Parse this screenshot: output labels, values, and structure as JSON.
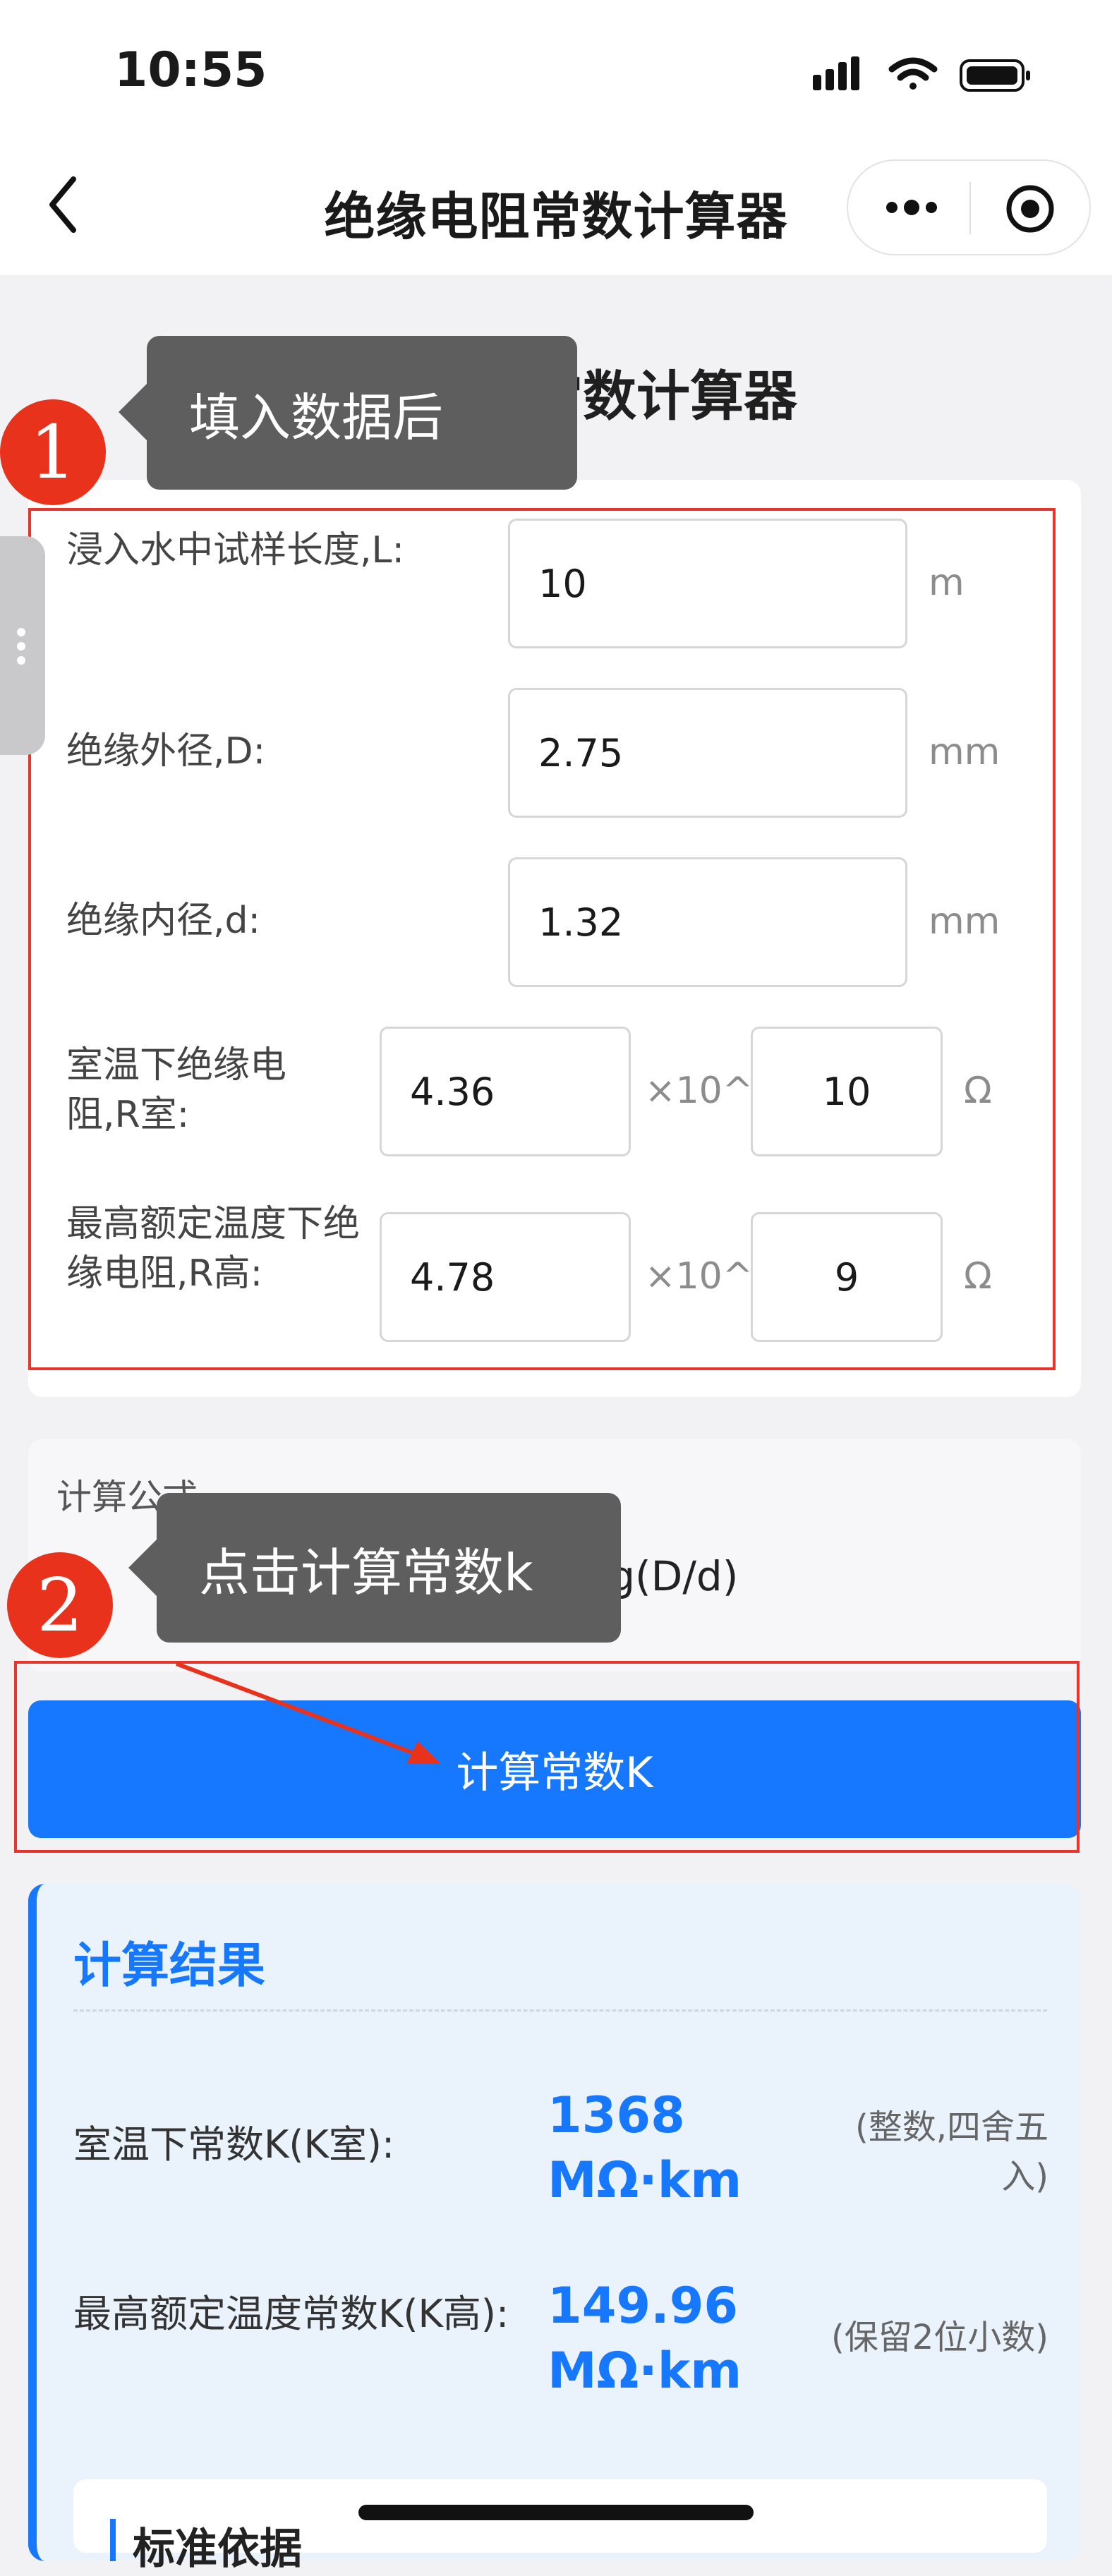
{
  "status_bar": {
    "time": "10:55"
  },
  "nav": {
    "title": "绝缘电阻常数计算器"
  },
  "page": {
    "heading": "绝缘电阻常数计算器"
  },
  "annotations": {
    "step1_badge": "1",
    "step1_tip": "填入数据后",
    "step2_badge": "2",
    "step2_tip": "点击计算常数k"
  },
  "form": {
    "length_label": "浸入水中试样长度,L:",
    "length_value": "10",
    "length_unit": "m",
    "outer_label": "绝缘外径,D:",
    "outer_value": "2.75",
    "outer_unit": "mm",
    "inner_label": "绝缘内径,d:",
    "inner_value": "1.32",
    "inner_unit": "mm",
    "rroom_label": "室温下绝缘电阻,R室:",
    "rroom_mantissa": "4.36",
    "rroom_times": "×10^",
    "rroom_exp": "10",
    "rroom_unit": "Ω",
    "rhigh_label": "最高额定温度下绝缘电阻,R高:",
    "rhigh_mantissa": "4.78",
    "rhigh_times": "×10^",
    "rhigh_exp": "9",
    "rhigh_unit": "Ω"
  },
  "formula": {
    "label": "计算公式",
    "text_visible": "(L × 10⁻⁹) / lg(D/d)"
  },
  "button": {
    "calculate_label": "计算常数K"
  },
  "result": {
    "title": "计算结果",
    "k_room_label": "室温下常数K(K室):",
    "k_room_value": "1368",
    "k_room_unit": "MΩ·km",
    "k_room_note": "(整数,四舍五入)",
    "k_high_label": "最高额定温度常数K(K高):",
    "k_high_value": "149.96",
    "k_high_unit": "MΩ·km",
    "k_high_note": "(保留2位小数)"
  },
  "standard": {
    "title": "标准依据"
  },
  "colors": {
    "accent": "#1677ff",
    "annotation_red": "#e8321c",
    "tooltip_gray": "#5e5e5e"
  }
}
